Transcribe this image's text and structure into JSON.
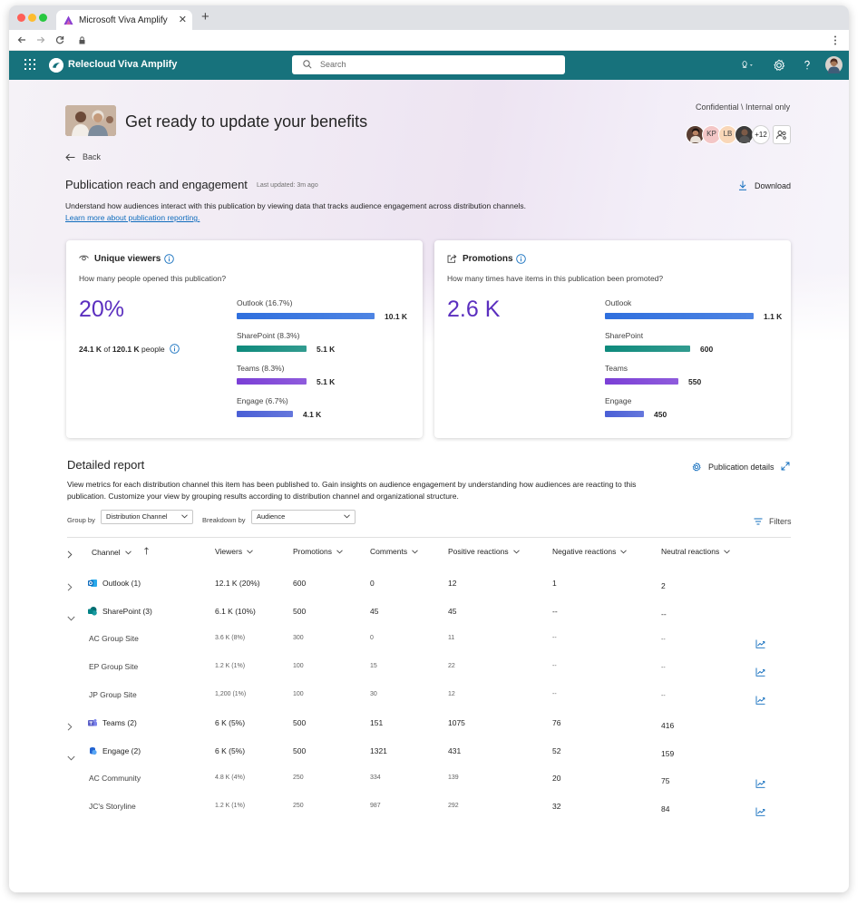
{
  "browser": {
    "tab_title": "Microsoft Viva Amplify",
    "new_tab": "+",
    "tab_close": "✕"
  },
  "app": {
    "brand": "Relecloud",
    "product": "Viva Amplify",
    "search_placeholder": "Search"
  },
  "publication": {
    "title": "Get ready to update your benefits",
    "sensitivity": "Confidential \\ Internal only",
    "collaborators": [
      {
        "initials": "",
        "color": "#5a3e33"
      },
      {
        "initials": "KP",
        "color": "#f3c6c6"
      },
      {
        "initials": "LB",
        "color": "#f9d7b8"
      },
      {
        "initials": "",
        "color": "#3b3b3b"
      }
    ],
    "more_collaborators": "+12",
    "back_label": "Back"
  },
  "reach": {
    "title": "Publication reach and engagement",
    "last_updated": "Last updated: 3m ago",
    "download_label": "Download",
    "description": "Understand how audiences interact with this publication by viewing data that tracks audience engagement across distribution channels.",
    "learn_more": "Learn more about publication reporting."
  },
  "colors": {
    "outlook": "#2f6fde",
    "sharepoint": "#0e8a7c",
    "teams": "#7b3fd6",
    "engage": "#4a5fd6",
    "accent": "#5b2fbf",
    "header": "#17727c"
  },
  "unique_viewers": {
    "title": "Unique viewers",
    "question": "How many people opened this publication?",
    "percent": "20%",
    "people_count": "24.1 K",
    "people_of": "of",
    "people_total": "120.1 K",
    "people_suffix": "people",
    "channels": [
      {
        "label": "Outlook  (16.7%)",
        "value": "10.1 K",
        "fraction": 1.0
      },
      {
        "label": "SharePoint  (8.3%)",
        "value": "5.1 K",
        "fraction": 0.505
      },
      {
        "label": "Teams (8.3%)",
        "value": "5.1 K",
        "fraction": 0.505
      },
      {
        "label": "Engage (6.7%)",
        "value": "4.1 K",
        "fraction": 0.406
      }
    ]
  },
  "promotions": {
    "title": "Promotions",
    "question": "How many times have items in this publication been promoted?",
    "total": "2.6 K",
    "channels": [
      {
        "label": "Outlook",
        "value": "1.1 K",
        "fraction": 1.0
      },
      {
        "label": "SharePoint",
        "value": "600",
        "fraction": 0.573
      },
      {
        "label": "Teams",
        "value": "550",
        "fraction": 0.494
      },
      {
        "label": "Engage",
        "value": "450",
        "fraction": 0.262
      }
    ]
  },
  "report": {
    "title": "Detailed report",
    "publication_details": "Publication details",
    "description": "View metrics for each distribution channel this item has been published to. Gain insights on audience engagement by understanding how audiences are reacting to this publication. Customize your view by grouping results according to distribution channel and organizational structure.",
    "group_by_label": "Group by",
    "group_by_value": "Distribution Channel",
    "breakdown_label": "Breakdown by",
    "breakdown_value": "Audience",
    "filters_label": "Filters",
    "columns": [
      "Channel",
      "Viewers",
      "Promotions",
      "Comments",
      "Positive reactions",
      "Negative reactions",
      "Neutral reactions"
    ],
    "rows": [
      {
        "type": "group",
        "expanded": false,
        "channel": "Outlook (1)",
        "icon": "outlook",
        "viewers": "12.1 K (20%)",
        "promotions": "600",
        "comments": "0",
        "positive": "12",
        "negative": "1",
        "neutral": "2",
        "trend": false
      },
      {
        "type": "group",
        "expanded": true,
        "channel": "SharePoint (3)",
        "icon": "sharepoint",
        "viewers": "6.1 K (10%)",
        "promotions": "500",
        "comments": "45",
        "positive": "45",
        "negative": "--",
        "neutral": "--",
        "trend": false
      },
      {
        "type": "child",
        "channel": "AC Group Site",
        "viewers": "3.6 K (8%)",
        "promotions": "300",
        "comments": "0",
        "positive": "11",
        "negative": "--",
        "neutral": "--",
        "trend": true
      },
      {
        "type": "child",
        "channel": "EP Group Site",
        "viewers": "1.2 K (1%)",
        "promotions": "100",
        "comments": "15",
        "positive": "22",
        "negative": "--",
        "neutral": "--",
        "trend": true
      },
      {
        "type": "child",
        "channel": "JP Group Site",
        "viewers": "1,200 (1%)",
        "promotions": "100",
        "comments": "30",
        "positive": "12",
        "negative": "--",
        "neutral": "--",
        "trend": true
      },
      {
        "type": "group",
        "expanded": false,
        "channel": "Teams (2)",
        "icon": "teams",
        "viewers": "6 K (5%)",
        "promotions": "500",
        "comments": "151",
        "positive": "1075",
        "negative": "76",
        "neutral": "416",
        "trend": false
      },
      {
        "type": "group",
        "expanded": true,
        "channel": "Engage (2)",
        "icon": "engage",
        "viewers": "6 K (5%)",
        "promotions": "500",
        "comments": "1321",
        "positive": "431",
        "negative": "52",
        "neutral": "159",
        "trend": false
      },
      {
        "type": "child",
        "channel": "AC Community",
        "viewers": "4.8 K (4%)",
        "promotions": "250",
        "comments": "334",
        "positive": "139",
        "negative": "20",
        "neutral": "75",
        "trend": true
      },
      {
        "type": "child",
        "channel": "JC's Storyline",
        "viewers": "1.2 K (1%)",
        "promotions": "250",
        "comments": "987",
        "positive": "292",
        "negative": "32",
        "neutral": "84",
        "trend": true
      }
    ]
  }
}
